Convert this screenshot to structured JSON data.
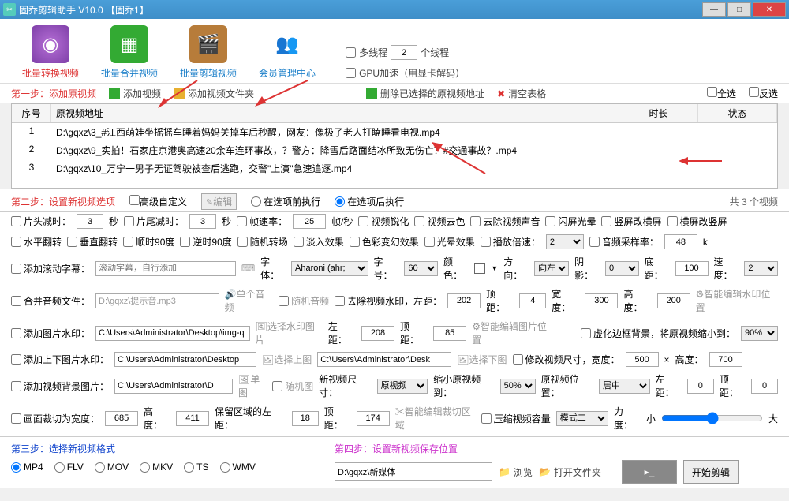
{
  "title": "固乔剪辑助手 V10.0   【固乔1】",
  "toolbar": {
    "convert": "批量转换视频",
    "merge": "批量合并视频",
    "edit": "批量剪辑视频",
    "member": "会员管理中心",
    "multithread": "多线程",
    "threads_value": "2",
    "threads_unit": "个线程",
    "gpu": "GPU加速（用显卡解码）"
  },
  "step1": {
    "label": "第一步：添加原视频",
    "add_video": "添加视频",
    "add_folder": "添加视频文件夹",
    "delete_selected": "删除已选择的原视频地址",
    "clear_table": "清空表格",
    "select_all": "全选",
    "invert_sel": "反选"
  },
  "table": {
    "headers": {
      "seq": "序号",
      "path": "原视频地址",
      "duration": "时长",
      "status": "状态"
    },
    "rows": [
      {
        "seq": "1",
        "path": "D:\\gqxz\\3_#江西萌娃坐摇摇车睡着妈妈关掉车后秒醒，网友：像极了老人打瞌睡看电视.mp4"
      },
      {
        "seq": "2",
        "path": "D:\\gqxz\\9_实拍！石家庄京港奥高速20余车连环事故，？警方：降雪后路面结冰所致无伤亡？#交通事故？.mp4"
      },
      {
        "seq": "3",
        "path": "D:\\gqxz\\10_万宁一男子无证驾驶被查后逃跑，交警\"上演\"急速追逐.mp4"
      }
    ]
  },
  "step2": {
    "label": "第二步：设置新视频选项",
    "adv_custom": "高级自定义",
    "edit_btn": "编辑",
    "exec_before": "在选项前执行",
    "exec_after": "在选项后执行",
    "count": "共 3 个视频"
  },
  "opt": {
    "head_trim": "片头减时：",
    "head_val": "3",
    "sec": "秒",
    "tail_trim": "片尾减时：",
    "tail_val": "3",
    "fps_label": "帧速率：",
    "fps_val": "25",
    "fps_unit": "帧/秒",
    "sharpen": "视频锐化",
    "desat": "视频去色",
    "mute": "去除视频声音",
    "flash": "闪屏光晕",
    "h2v": "竖屏改横屏",
    "v2h": "横屏改竖屏",
    "hflip": "水平翻转",
    "vflip": "垂直翻转",
    "cw90": "顺时90度",
    "ccw90": "逆时90度",
    "transition": "随机转场",
    "fadein": "淡入效果",
    "colorshift": "色彩变幻效果",
    "glow": "光晕效果",
    "speed_label": "播放倍速：",
    "speed_val": "2",
    "audio_rate": "音频采样率：",
    "audio_rate_val": "48",
    "k": "k",
    "subtitle": "添加滚动字幕：",
    "subtitle_ph": "滚动字幕，自行添加",
    "font_label": "字体：",
    "font_val": "Aharoni (ahr;",
    "fontsize": "字号：",
    "fontsize_val": "60",
    "color": "颜色：",
    "dir": "方向：",
    "dir_val": "向左",
    "shadow": "阴影：",
    "shadow_val": "0",
    "bottom": "底距：",
    "bottom_val": "100",
    "subspeed": "速度：",
    "subspeed_val": "2",
    "merge_audio": "合并音频文件：",
    "merge_audio_path": "D:\\gqxz\\提示音.mp3",
    "single_audio": "单个音频",
    "random_audio": "随机音频",
    "remove_wm": "去除视频水印，左距：",
    "wm_left": "202",
    "wm_top_l": "顶距：",
    "wm_top": "4",
    "wm_w_l": "宽度：",
    "wm_w": "300",
    "wm_h_l": "高度：",
    "wm_h": "200",
    "smart_wm": "智能编辑水印位置",
    "add_img_wm": "添加图片水印：",
    "img_wm_path": "C:\\Users\\Administrator\\Desktop\\img-q",
    "sel_wm_img": "选择水印图片",
    "img_left_l": "左距：",
    "img_left": "208",
    "img_top_l": "顶距：",
    "img_top": "85",
    "smart_img": "智能编辑图片位置",
    "vborder": "虚化边框背景，将原视频缩小到：",
    "vborder_val": "90%",
    "add_tb_wm": "添加上下图片水印：",
    "tb_path": "C:\\Users\\Administrator\\Desktop",
    "sel_top": "选择上图",
    "tb_path2": "C:\\Users\\Administrator\\Desk",
    "sel_bot": "选择下图",
    "resize": "修改视频尺寸，宽度：",
    "resize_w": "500",
    "resize_h_l": "高度：",
    "resize_h": "700",
    "add_bg": "添加视频背景图片：",
    "bg_path": "C:\\Users\\Administrator\\D",
    "single_img": "单图",
    "random_img": "随机图",
    "new_size": "新视频尺寸：",
    "new_size_v": "原视频",
    "shrink": "缩小原视频到：",
    "shrink_v": "50%",
    "pos": "原视频位置：",
    "pos_v": "居中",
    "bg_left_l": "左距：",
    "bg_left": "0",
    "bg_top_l": "顶距：",
    "bg_top": "0",
    "crop": "画面裁切为宽度：",
    "crop_w": "685",
    "crop_h_l": "高度：",
    "crop_h": "411",
    "keep_left_l": "保留区域的左距：",
    "keep_left": "18",
    "keep_top_l": "顶距：",
    "keep_top": "174",
    "smart_crop": "智能编辑裁切区域",
    "compress": "压缩视频容量",
    "mode": "模式二",
    "force": "力度：",
    "small": "小",
    "big": "大"
  },
  "step3": {
    "label": "第三步：选择新视频格式",
    "mp4": "MP4",
    "flv": "FLV",
    "mov": "MOV",
    "mkv": "MKV",
    "ts": "TS",
    "wmv": "WMV"
  },
  "step4": {
    "label": "第四步：设置新视频保存位置",
    "path": "D:\\gqxz\\新媒体",
    "browse": "浏览",
    "open_folder": "打开文件夹",
    "start": "开始剪辑"
  }
}
